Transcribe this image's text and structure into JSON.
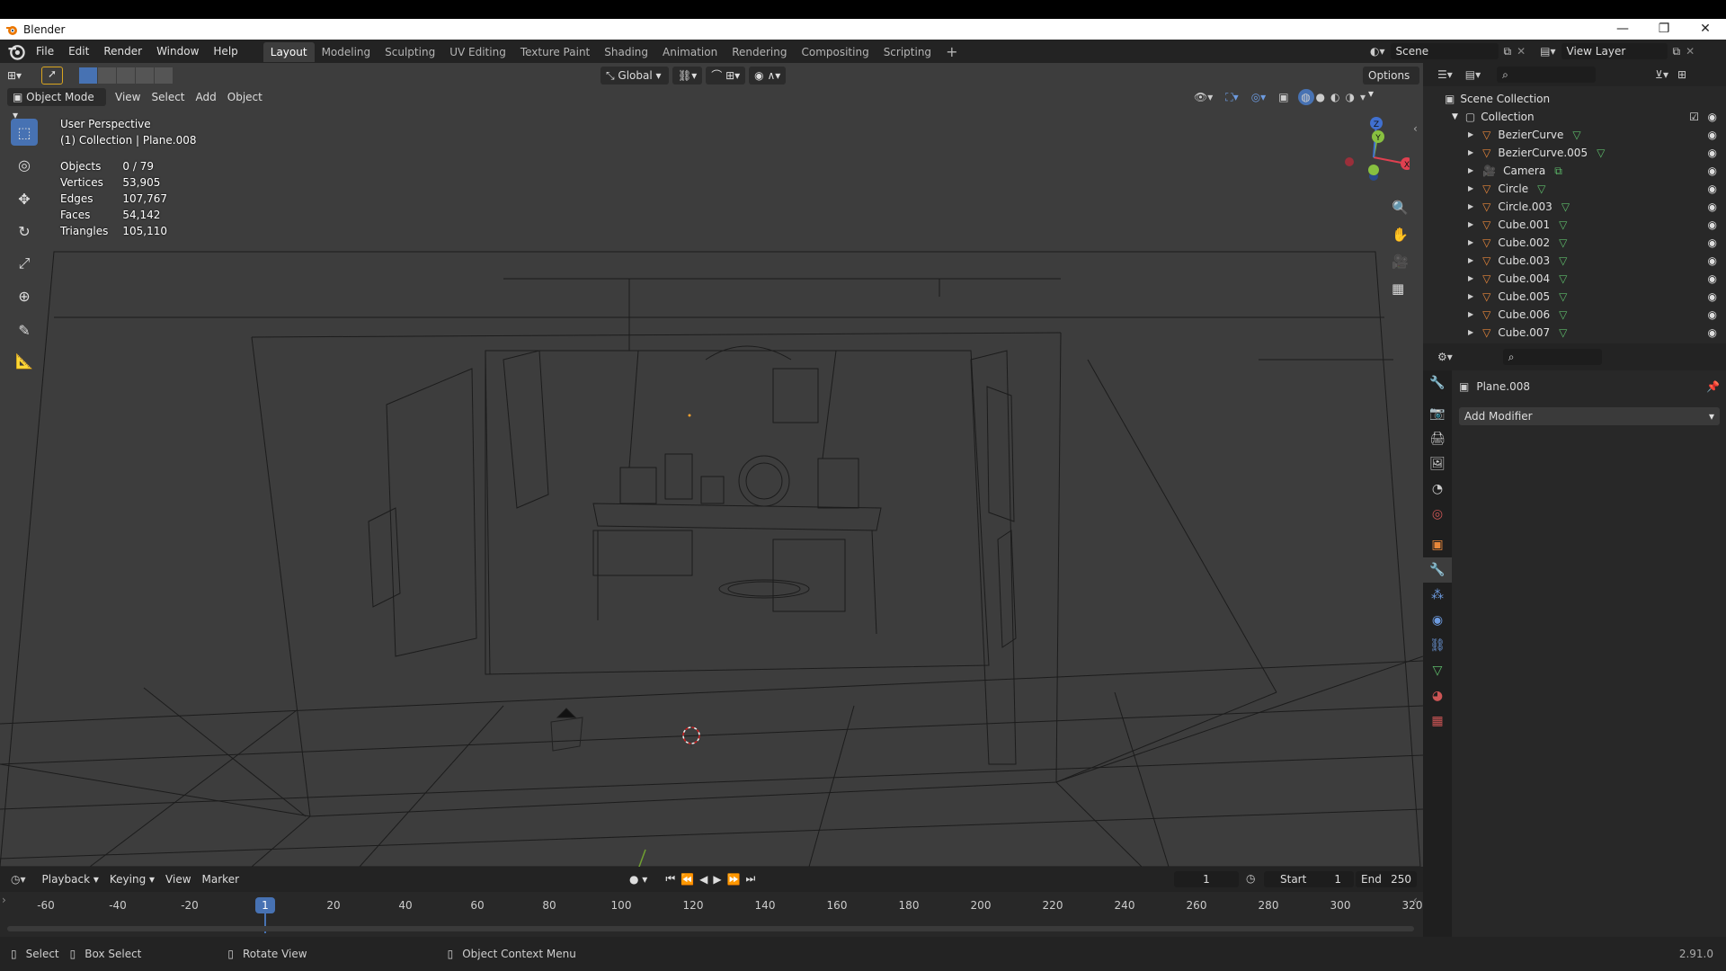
{
  "window": {
    "title": "Blender",
    "controls": [
      "—",
      "❐",
      "✕"
    ]
  },
  "menu": [
    "File",
    "Edit",
    "Render",
    "Window",
    "Help"
  ],
  "workspaces": [
    "Layout",
    "Modeling",
    "Sculpting",
    "UV Editing",
    "Texture Paint",
    "Shading",
    "Animation",
    "Rendering",
    "Compositing",
    "Scripting"
  ],
  "scene": {
    "name": "Scene",
    "view_layer": "View Layer"
  },
  "viewport": {
    "mode": "Object Mode",
    "menus": [
      "View",
      "Select",
      "Add",
      "Object"
    ],
    "transform_orientation": "Global",
    "options_label": "Options",
    "perspective": "User Perspective",
    "context": "(1) Collection | Plane.008",
    "stats": {
      "objects_label": "Objects",
      "objects": "0 / 79",
      "vertices_label": "Vertices",
      "vertices": "53,905",
      "edges_label": "Edges",
      "edges": "107,767",
      "faces_label": "Faces",
      "faces": "54,142",
      "triangles_label": "Triangles",
      "triangles": "105,110"
    },
    "gizmo": {
      "x": "X",
      "y": "Y",
      "z": "Z"
    }
  },
  "outliner": {
    "root": "Scene Collection",
    "collection": "Collection",
    "items": [
      {
        "name": "BezierCurve",
        "type": "curve"
      },
      {
        "name": "BezierCurve.005",
        "type": "curve"
      },
      {
        "name": "Camera",
        "type": "camera"
      },
      {
        "name": "Circle",
        "type": "curve"
      },
      {
        "name": "Circle.003",
        "type": "mesh"
      },
      {
        "name": "Cube.001",
        "type": "mesh"
      },
      {
        "name": "Cube.002",
        "type": "mesh"
      },
      {
        "name": "Cube.003",
        "type": "mesh"
      },
      {
        "name": "Cube.004",
        "type": "mesh"
      },
      {
        "name": "Cube.005",
        "type": "mesh"
      },
      {
        "name": "Cube.006",
        "type": "mesh"
      },
      {
        "name": "Cube.007",
        "type": "mesh"
      }
    ]
  },
  "properties": {
    "object_name": "Plane.008",
    "add_modifier": "Add Modifier"
  },
  "timeline": {
    "menus": [
      "Playback",
      "Keying",
      "View",
      "Marker"
    ],
    "current_frame": "1",
    "start_label": "Start",
    "start": "1",
    "end_label": "End",
    "end": "250",
    "ticks": [
      "-60",
      "-40",
      "-20",
      "1",
      "20",
      "40",
      "60",
      "80",
      "100",
      "120",
      "140",
      "160",
      "180",
      "200",
      "220",
      "240",
      "260",
      "280",
      "300",
      "320"
    ]
  },
  "status": {
    "select": "Select",
    "box_select": "Box Select",
    "rotate_view": "Rotate View",
    "context_menu": "Object Context Menu",
    "version": "2.91.0"
  },
  "colors": {
    "accent": "#4772b3",
    "viewport_bg": "#3d3d3d",
    "panel_bg": "#282828",
    "header_bg": "#232323",
    "mesh_icon": "#e8873a",
    "data_icon": "#5dbb6a",
    "axis_x": "#e04050",
    "axis_y": "#88c040",
    "axis_z": "#4070d0"
  }
}
